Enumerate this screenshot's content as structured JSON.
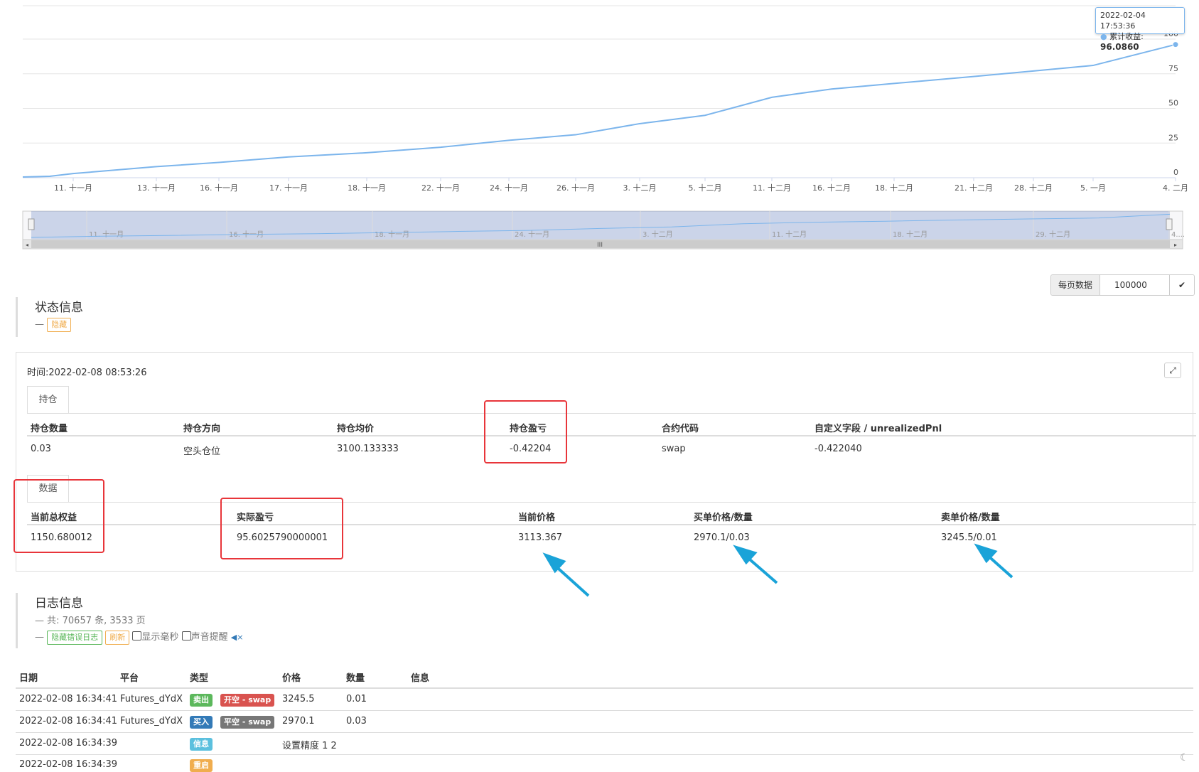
{
  "chart_data": {
    "type": "line",
    "x": [
      "11. 十一月",
      "13. 十一月",
      "16. 十一月",
      "17. 十一月",
      "18. 十一月",
      "22. 十一月",
      "24. 十一月",
      "26. 十一月",
      "3. 十二月",
      "5. 十二月",
      "11. 十二月",
      "16. 十二月",
      "18. 十二月",
      "21. 十二月",
      "28. 十二月",
      "5. 一月",
      "4. 二月"
    ],
    "series": [
      {
        "name": "累计收益",
        "values": [
          3,
          8,
          11,
          15,
          18,
          22,
          27,
          31,
          39,
          45,
          58,
          64,
          68,
          73,
          77,
          81,
          96.086
        ]
      }
    ],
    "ylim": [
      0,
      100
    ],
    "yticks": [
      "0",
      "25",
      "50",
      "75",
      "100"
    ],
    "grid": true,
    "tooltip": {
      "date": "2022-02-04 17:53:36",
      "label": "累计收益",
      "value": "96.0860"
    },
    "navigator_labels": [
      "11. 十一月",
      "16. 十一月",
      "18. 十一月",
      "24. 十一月",
      "3. 十二月",
      "11. 十二月",
      "18. 十二月",
      "29. 十二月",
      "4...."
    ],
    "navigator_scroll_label": "III"
  },
  "per_page": {
    "label": "每页数据",
    "value": "100000",
    "confirm": "✔"
  },
  "status": {
    "title": "状态信息",
    "dash": "—",
    "hide_label": "隐藏",
    "time_label": "时间:",
    "time_value": "2022-02-08 08:53:26",
    "position_tab": "持仓",
    "position_headers": [
      "持仓数量",
      "持仓方向",
      "持仓均价",
      "持仓盈亏",
      "合约代码",
      "自定义字段 / unrealizedPnl"
    ],
    "position_row": [
      "0.03",
      "空头仓位",
      "3100.133333",
      "-0.42204",
      "swap",
      "-0.422040"
    ],
    "data_tab": "数据",
    "data_headers": [
      "当前总权益",
      "实际盈亏",
      "当前价格",
      "买单价格/数量",
      "卖单价格/数量"
    ],
    "data_row": [
      "1150.680012",
      "95.6025790000001",
      "3113.367",
      "2970.1/0.03",
      "3245.5/0.01"
    ]
  },
  "log": {
    "title": "日志信息",
    "summary": "— 共: 70657 条, 3533 页",
    "dash": "—",
    "hide_error_label": "隐藏错误日志",
    "refresh_label": "刷新",
    "show_ms_label": "显示毫秒",
    "sound_label": "声音提醒",
    "headers": [
      "日期",
      "平台",
      "类型",
      "价格",
      "数量",
      "信息"
    ],
    "rows": [
      {
        "date": "2022-02-08 16:34:41",
        "platform": "Futures_dYdX",
        "type": "卖出",
        "subtype": "开空 - swap",
        "price": "3245.5",
        "amount": "0.01",
        "info": ""
      },
      {
        "date": "2022-02-08 16:34:41",
        "platform": "Futures_dYdX",
        "type": "买入",
        "subtype": "平空 - swap",
        "price": "2970.1",
        "amount": "0.03",
        "info": ""
      },
      {
        "date": "2022-02-08 16:34:39",
        "platform": "",
        "type": "信息",
        "subtype": "",
        "price": "设置精度 1 2",
        "amount": "",
        "info": ""
      },
      {
        "date": "2022-02-08 16:34:39",
        "platform": "",
        "type": "重启",
        "subtype": "",
        "price": "",
        "amount": "",
        "info": ""
      }
    ]
  },
  "colors": {
    "line": "#7cb5ec",
    "annotation_box": "#e8353a",
    "arrow": "#1aa3d8"
  }
}
